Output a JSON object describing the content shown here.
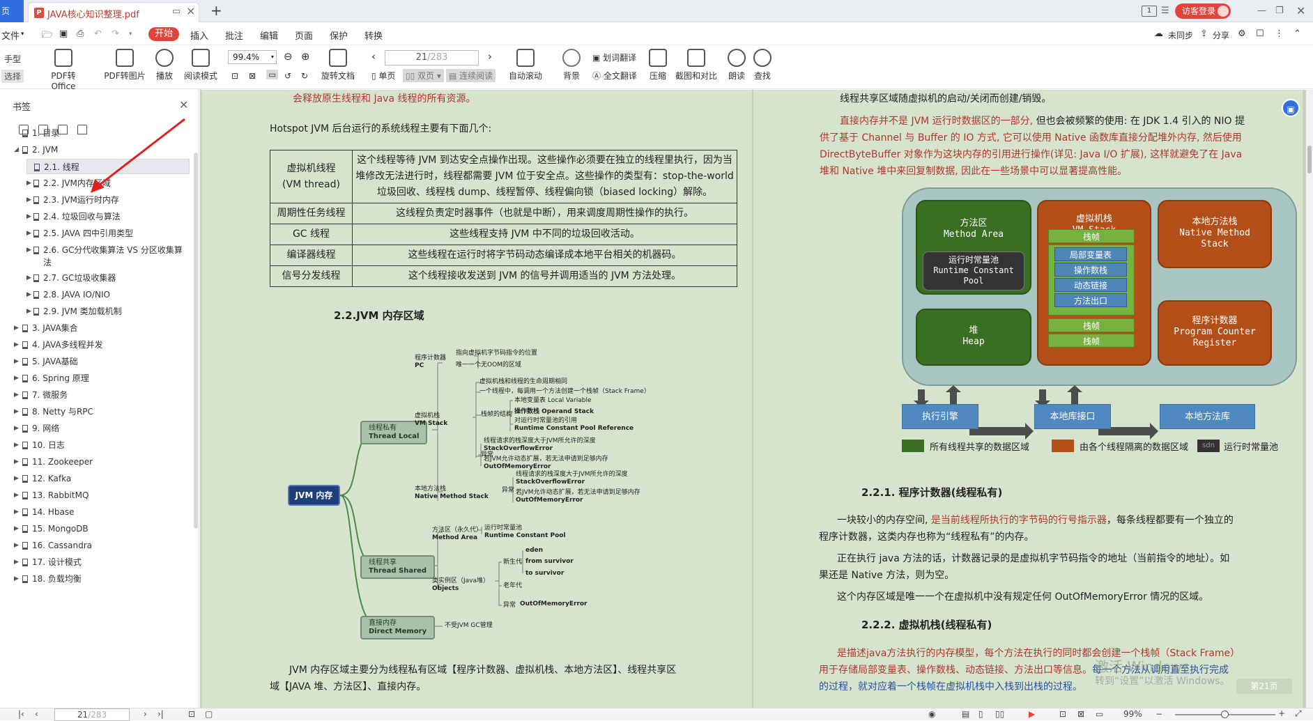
{
  "tabbar": {
    "home": "页",
    "doc_title": "JAVA核心知识整理.pdf",
    "page_badge": "1",
    "visitor": "访客登录"
  },
  "menu": {
    "file": "文件",
    "start": "开始",
    "items": [
      "插入",
      "批注",
      "编辑",
      "页面",
      "保护",
      "转换"
    ],
    "sync": "未同步",
    "share": "分享"
  },
  "toolbar": {
    "hand": "手型",
    "select": "选择",
    "pdf_office": "PDF转Office",
    "pdf_image": "PDF转图片",
    "play": "播放",
    "read_mode": "阅读模式",
    "zoom": "99.4%",
    "rotate": "旋转文档",
    "page_value": "21",
    "page_total": "/283",
    "single": "单页",
    "double": "双页",
    "continuous": "连续阅读",
    "auto_scroll": "自动滚动",
    "background": "背景",
    "word_translate": "划词翻译",
    "full_translate": "全文翻译",
    "compress": "压缩",
    "screenshot": "截图和对比",
    "read_aloud": "朗读",
    "find": "查找"
  },
  "sidebar": {
    "title": "书签",
    "items": [
      {
        "label": "1. 目录",
        "level": 0,
        "expand": ""
      },
      {
        "label": "2. JVM",
        "level": 0,
        "expand": "open"
      },
      {
        "label": "2.1. 线程",
        "level": 1,
        "expand": "",
        "active": true
      },
      {
        "label": "2.2. JVM内存区域",
        "level": 1,
        "expand": "closed"
      },
      {
        "label": "2.3. JVM运行时内存",
        "level": 1,
        "expand": "closed"
      },
      {
        "label": "2.4. 垃圾回收与算法",
        "level": 1,
        "expand": "closed"
      },
      {
        "label": "2.5. JAVA 四中引用类型",
        "level": 1,
        "expand": "closed"
      },
      {
        "label": "2.6. GC分代收集算法  VS 分区收集算",
        "label2": "法",
        "level": 1,
        "expand": "closed"
      },
      {
        "label": "2.7. GC垃圾收集器",
        "level": 1,
        "expand": "closed"
      },
      {
        "label": "2.8.  JAVA IO/NIO",
        "level": 1,
        "expand": "closed"
      },
      {
        "label": "2.9. JVM 类加载机制",
        "level": 1,
        "expand": "closed"
      },
      {
        "label": "3. JAVA集合",
        "level": 0,
        "expand": "closed"
      },
      {
        "label": "4. JAVA多线程并发",
        "level": 0,
        "expand": "closed"
      },
      {
        "label": "5. JAVA基础",
        "level": 0,
        "expand": "closed"
      },
      {
        "label": "6. Spring 原理",
        "level": 0,
        "expand": "closed"
      },
      {
        "label": "7.    微服务",
        "level": 0,
        "expand": "closed"
      },
      {
        "label": "8. Netty 与RPC",
        "level": 0,
        "expand": "closed"
      },
      {
        "label": "9. 网络",
        "level": 0,
        "expand": "closed"
      },
      {
        "label": "10. 日志",
        "level": 0,
        "expand": "closed"
      },
      {
        "label": "11. Zookeeper",
        "level": 0,
        "expand": "closed"
      },
      {
        "label": "12. Kafka",
        "level": 0,
        "expand": "closed"
      },
      {
        "label": "13. RabbitMQ",
        "level": 0,
        "expand": "closed"
      },
      {
        "label": "14. Hbase",
        "level": 0,
        "expand": "closed"
      },
      {
        "label": "15. MongoDB",
        "level": 0,
        "expand": "closed"
      },
      {
        "label": "16. Cassandra",
        "level": 0,
        "expand": "closed"
      },
      {
        "label": "17. 设计模式",
        "level": 0,
        "expand": "closed"
      },
      {
        "label": "18. 负载均衡",
        "level": 0,
        "expand": "closed"
      }
    ]
  },
  "page_left": {
    "line1": "会释放原生线程和 Java 线程的所有资源。",
    "intro": "Hotspot JVM 后台运行的系统线程主要有下面几个:",
    "table": [
      {
        "name": "虚拟机线程\n(VM thread)",
        "desc": "这个线程等待 JVM 到达安全点操作出现。这些操作必须要在独立的线程里执行，因为当堆修改无法进行时，线程都需要 JVM 位于安全点。这些操作的类型有：stop-the-world 垃圾回收、线程栈 dump、线程暂停、线程偏向锁（biased locking）解除。"
      },
      {
        "name": "周期性任务线程",
        "desc": "这线程负责定时器事件（也就是中断），用来调度周期性操作的执行。"
      },
      {
        "name": "GC 线程",
        "desc": "这些线程支持 JVM 中不同的垃圾回收活动。"
      },
      {
        "name": "编译器线程",
        "desc": "这些线程在运行时将字节码动态编译成本地平台相关的机器码。"
      },
      {
        "name": "信号分发线程",
        "desc": "这个线程接收发送到 JVM 的信号并调用适当的 JVM 方法处理。"
      }
    ],
    "section": "2.2.JVM 内存区域",
    "mind": {
      "root": "JVM 内存",
      "thread_local": "线程私有",
      "thread_local_en": "Thread Local",
      "thread_shared": "线程共享",
      "thread_shared_en": "Thread Shared",
      "direct": "直接内存",
      "direct_en": "Direct Memory",
      "pc": "程序计数器",
      "pc_en": "PC",
      "pc1": "指向虚拟机字节码指令的位置",
      "pc2": "唯一一个无OOM的区域",
      "vmstack": "虚拟机栈",
      "vmstack_en": "VM Stack",
      "vs1": "虚拟机栈和线程的生命周期相同",
      "vs2": "一个线程中，每调用一个方法创建一个栈帧（Stack Frame）",
      "frame": "栈帧的结构",
      "f1": "本地变量表 Local Variable",
      "f2": "操作数栈 Operand Stack",
      "f3": "对运行时常量池的引用",
      "f4": "Runtime Constant Pool Reference",
      "exc": "异常",
      "e1": "线程请求的栈深度大于JVM所允许的深度",
      "e2": "StackOverflowError",
      "e3": "若JVM允许动态扩展，若无法申请到足够内存",
      "e4": "OutOfMemoryError",
      "native": "本地方法栈",
      "native_en": "Native Method Stack",
      "n_exc": "异常",
      "n1": "线程请求的栈深度大于JVM所允许的深度",
      "n2": "StackOverflowError",
      "n3": "若JVM允许动态扩展，若无法申请到足够内存",
      "n4": "OutOfMemoryError",
      "method": "方法区（永久代）",
      "method_en": "Method Area",
      "m1": "运行时常量池",
      "m2": "Runtime Constant Pool",
      "heap": "类实例区（Java堆）",
      "heap_en": "Objects",
      "young": "新生代",
      "eden": "eden",
      "from": "from survivor",
      "to": "to survivor",
      "old": "老年代",
      "h_exc": "异常",
      "h_oom": "OutOfMemoryError",
      "d1": "不受JVM GC管理"
    },
    "bottom1": "JVM 内存区域主要分为线程私有区域【程序计数器、虚拟机栈、本地方法区】、线程共享区",
    "bottom2": "域【JAVA 堆、方法区】、直接内存。"
  },
  "page_right": {
    "top": "线程共享区域随虚拟机的启动/关闭而创建/销毁。",
    "p1a": "直接内存并不是 JVM 运行时数据区的一部分,",
    "p1b": " 但也会被频繁的使用: 在 JDK 1.4 引入的 NIO 提",
    "p1c": "供了基于 Channel 与 Buffer 的 IO 方式, 它可以使用 Native 函数库直接分配堆外内存, 然后使用",
    "p1d": "DirectByteBuffer 对象作为这块内存的引用进行操作(详见: Java I/O 扩展), 这样就避免了在 Java",
    "p1e": "堆和 Native 堆中来回复制数据, 因此在一些场景中可以显著提高性能。",
    "diagram": {
      "method_area": "方法区",
      "method_area_en": "Method Area",
      "rcp": "运行时常量池",
      "rcp_en1": "Runtime Constant",
      "rcp_en2": "Pool",
      "heap": "堆",
      "heap_en": "Heap",
      "vm_stack": "虚拟机栈",
      "vm_stack_en": "VM Stack",
      "frame": "栈帧",
      "lv": "局部变量表",
      "os": "操作数栈",
      "dl": "动态链接",
      "ra": "方法出口",
      "nms": "本地方法栈",
      "nms_en1": "Native Method",
      "nms_en2": "Stack",
      "pcr": "程序计数器",
      "pcr_en1": "Program Counter",
      "pcr_en2": "Register",
      "engine": "执行引擎",
      "native_if": "本地库接口",
      "native_lib": "本地方法库",
      "leg1": "所有线程共享的数据区域",
      "leg2": "由各个线程隔离的数据区域",
      "leg3_badge": "sdn",
      "leg3": "运行时常量池",
      "color_shared": "#3a6f23",
      "color_isolated": "#b3501a"
    },
    "s221": "2.2.1.  程序计数器(线程私有)",
    "p2a": "一块较小的内存空间, ",
    "p2b": "是当前线程所执行的字节码的行号指示器",
    "p2c": "，每条线程都要有一个独立的",
    "p2d": "程序计数器，这类内存也称为“线程私有”的内存。",
    "p3a": "正在执行 java 方法的话，计数器记录的是虚拟机字节码指令的地址（当前指令的地址）。如",
    "p3b": "果还是 Native 方法，则为空。",
    "p4": "这个内存区域是唯一一个在虚拟机中没有规定任何 OutOfMemoryError 情况的区域。",
    "s222": "2.2.2.  虚拟机栈(线程私有)",
    "p5a": "是描述java方法执行的内存模型，每个方法在执行的同时都会创建一个栈帧（Stack Frame）",
    "p5b": "用于存储局部变量表、操作数栈、动态链接、方法出口等信息。",
    "p5c": "每一个方法从调用直至执行完成",
    "p5d": "的过程，就对应着一个栈帧在虚拟机栈中入栈到出栈的过程。",
    "wm1": "激活 Windows",
    "wm2": "转到“设置”以激活 Windows。",
    "page_tag": "第21页"
  },
  "status": {
    "page_value": "21",
    "page_total": "/283",
    "zoom": "99%"
  }
}
